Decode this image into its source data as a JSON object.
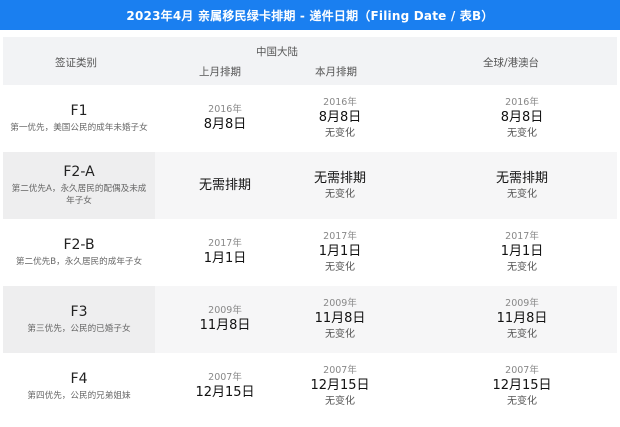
{
  "banner": {
    "title": "2023年4月 亲属移民绿卡排期 - 递件日期（Filing Date / 表B）"
  },
  "header": {
    "category": "签证类别",
    "china": "中国大陆",
    "last_month": "上月排期",
    "this_month": "本月排期",
    "global": "全球/港澳台"
  },
  "rows": [
    {
      "code": "F1",
      "desc": "第一优先，美国公民的成年未婚子女",
      "last": {
        "year": "2016年",
        "date": "8月8日"
      },
      "this": {
        "year": "2016年",
        "date": "8月8日",
        "note": "无变化"
      },
      "global": {
        "year": "2016年",
        "date": "8月8日",
        "note": "无变化"
      }
    },
    {
      "code": "F2-A",
      "desc": "第二优先A，永久居民的配偶及未成年子女",
      "last": {
        "year": "",
        "date": "无需排期"
      },
      "this": {
        "year": "",
        "date": "无需排期",
        "note": "无变化"
      },
      "global": {
        "year": "",
        "date": "无需排期",
        "note": "无变化"
      }
    },
    {
      "code": "F2-B",
      "desc": "第二优先B，永久居民的成年子女",
      "last": {
        "year": "2017年",
        "date": "1月1日"
      },
      "this": {
        "year": "2017年",
        "date": "1月1日",
        "note": "无变化"
      },
      "global": {
        "year": "2017年",
        "date": "1月1日",
        "note": "无变化"
      }
    },
    {
      "code": "F3",
      "desc": "第三优先，公民的已婚子女",
      "last": {
        "year": "2009年",
        "date": "11月8日"
      },
      "this": {
        "year": "2009年",
        "date": "11月8日",
        "note": "无变化"
      },
      "global": {
        "year": "2009年",
        "date": "11月8日",
        "note": "无变化"
      }
    },
    {
      "code": "F4",
      "desc": "第四优先，公民的兄弟姐妹",
      "last": {
        "year": "2007年",
        "date": "12月15日"
      },
      "this": {
        "year": "2007年",
        "date": "12月15日",
        "note": "无变化"
      },
      "global": {
        "year": "2007年",
        "date": "12月15日",
        "note": "无变化"
      }
    }
  ]
}
